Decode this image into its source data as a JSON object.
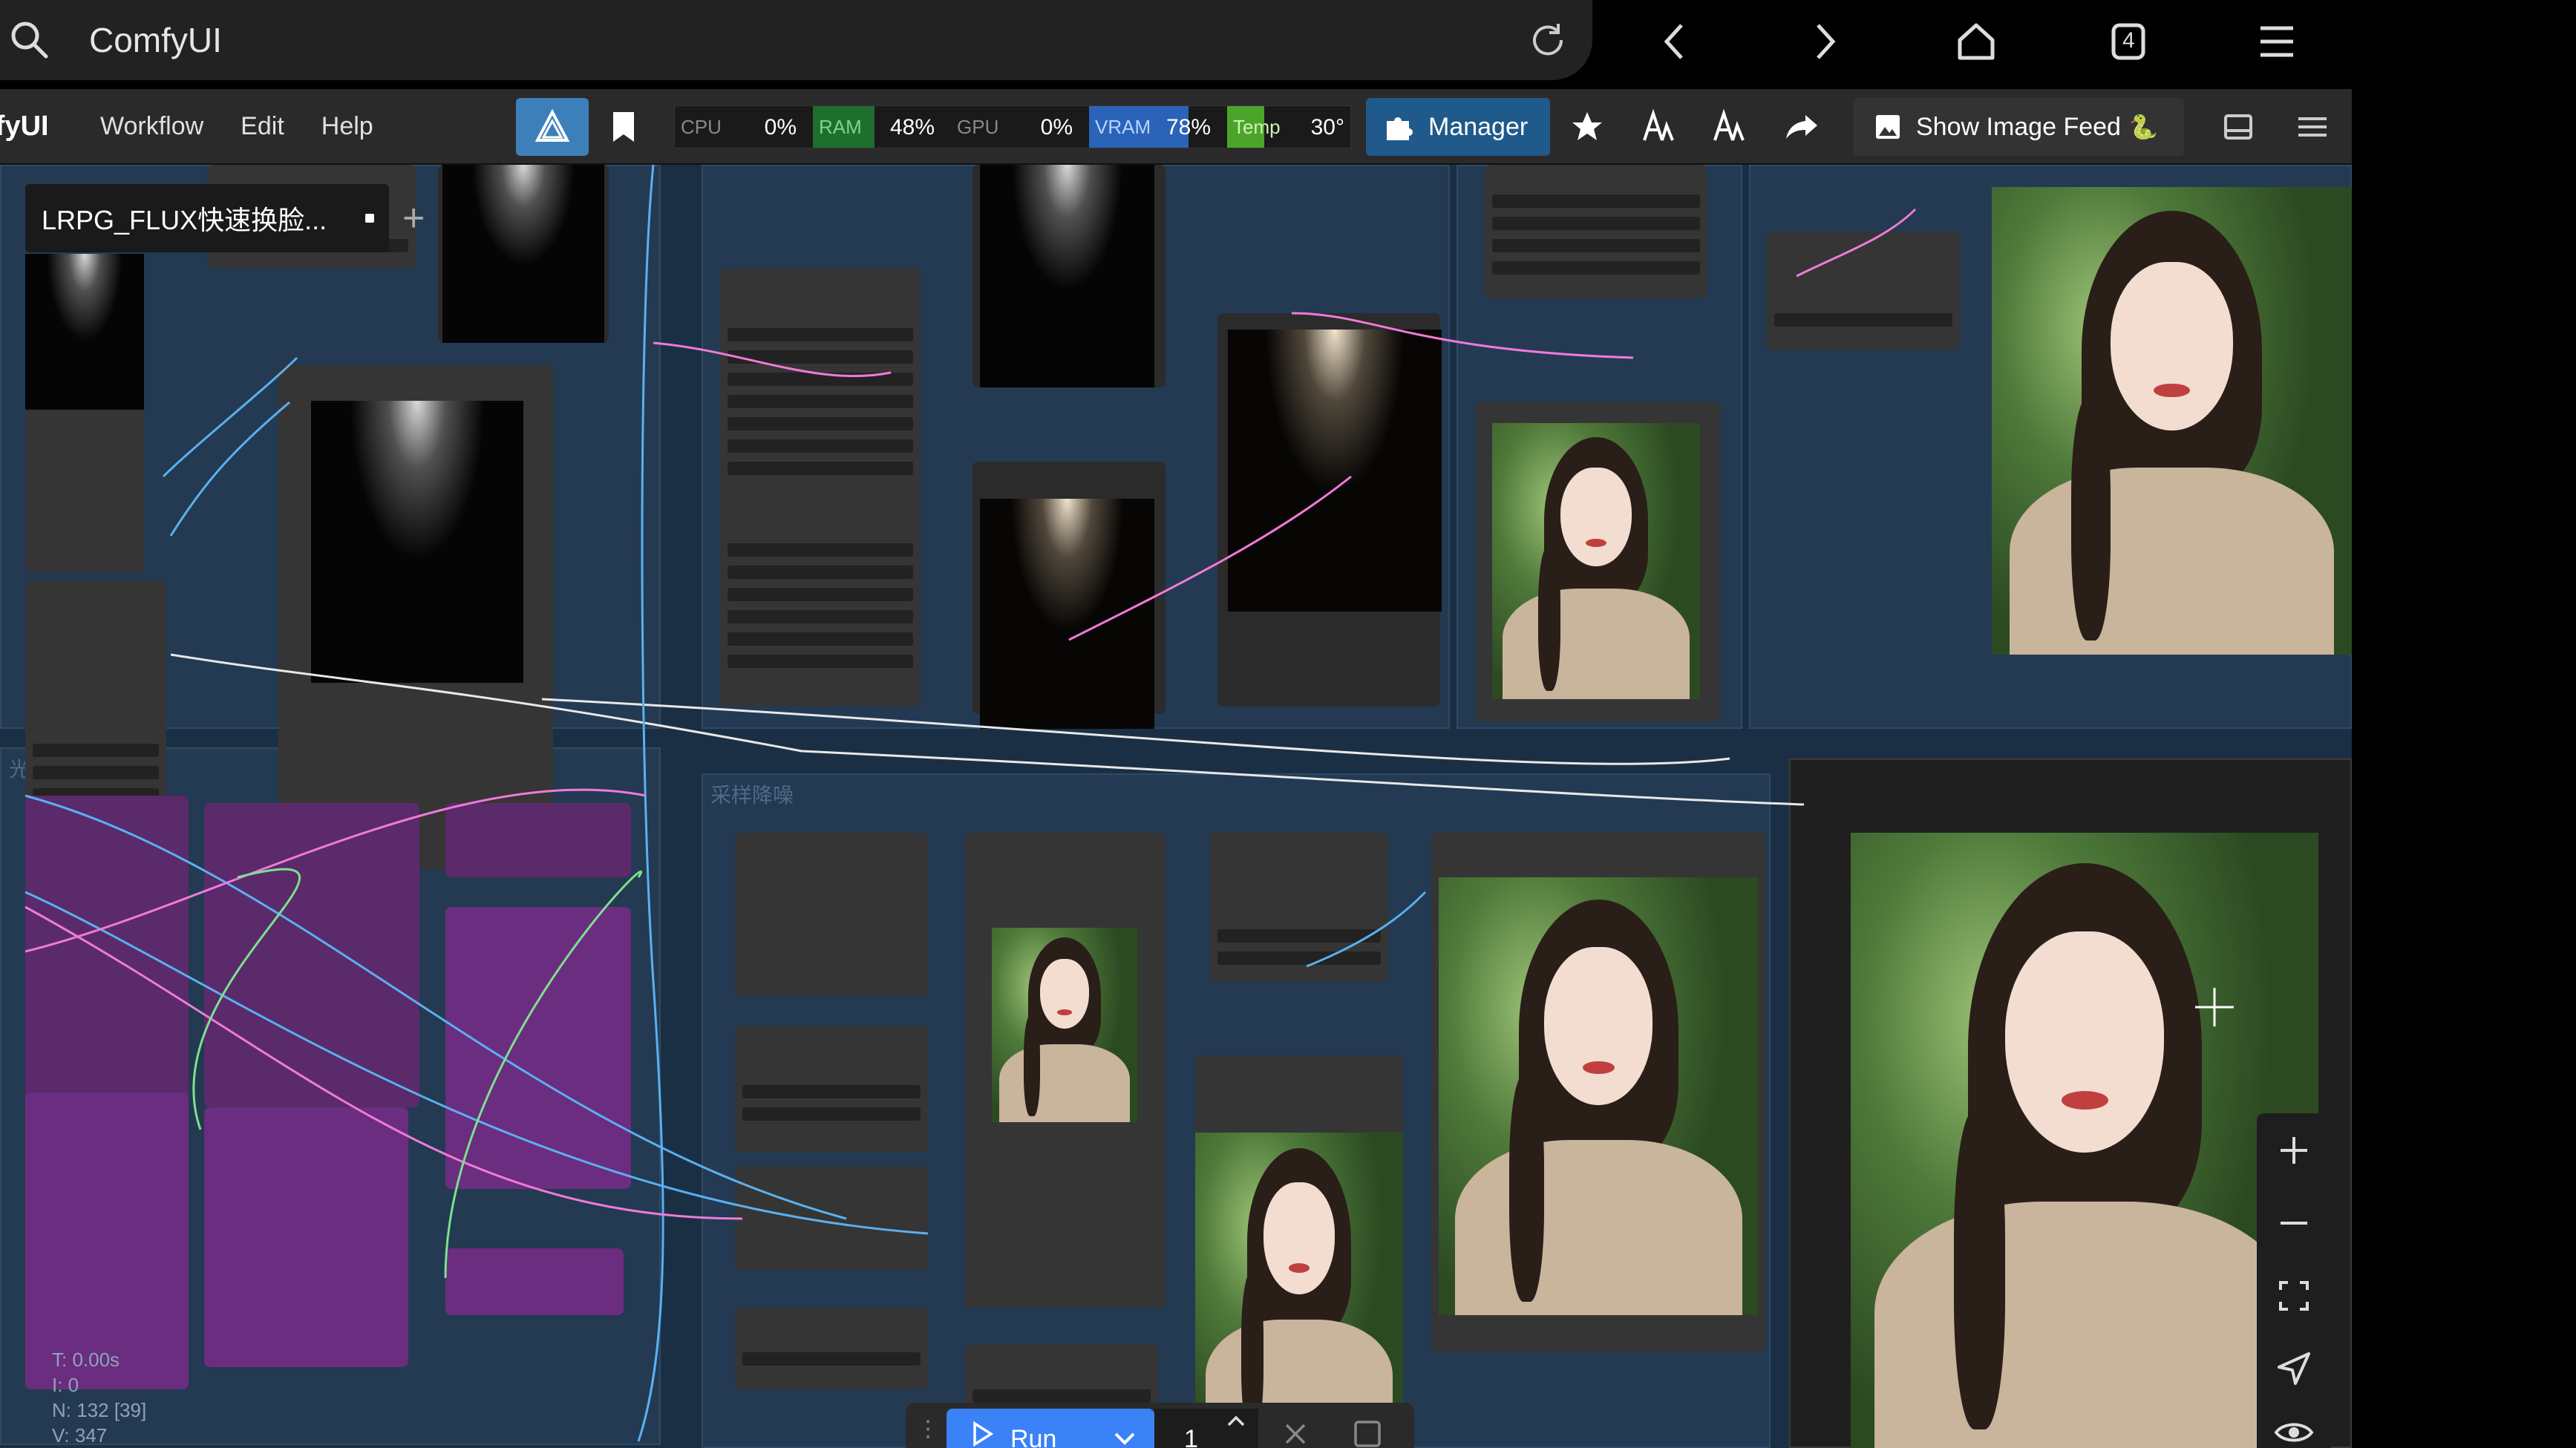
{
  "browser": {
    "url_title": "ComfyUI",
    "tab_count": "4"
  },
  "menubar": {
    "brand": "mfyUI",
    "items": [
      "Workflow",
      "Edit",
      "Help"
    ],
    "manager_label": "Manager",
    "image_feed_label": "Show Image Feed"
  },
  "monitor": {
    "cpu_label": "CPU",
    "cpu_value": "0%",
    "ram_label": "RAM",
    "ram_value": "48%",
    "gpu_label": "GPU",
    "gpu_value": "0%",
    "vram_label": "VRAM",
    "vram_value": "78%",
    "temp_label": "Temp",
    "temp_value": "30°",
    "ram_fill": 0.48,
    "vram_fill": 0.78,
    "temp_fill": 0.3
  },
  "workflow_tab": {
    "title": "LRPG_FLUX快速换脸..."
  },
  "groups": {
    "light_source": "光源",
    "sampling": "采样降噪"
  },
  "stats": {
    "t": "T: 0.00s",
    "i": "I: 0",
    "n": "N: 132 [39]",
    "v": "V: 347"
  },
  "runbar": {
    "run_label": "Run",
    "queue_count": "1"
  },
  "colors": {
    "accent": "#3b82f6",
    "canvas": "#1b2f44",
    "group": "#233a52",
    "link_blue": "#5ab0f0",
    "link_pink": "#f07ad8"
  }
}
